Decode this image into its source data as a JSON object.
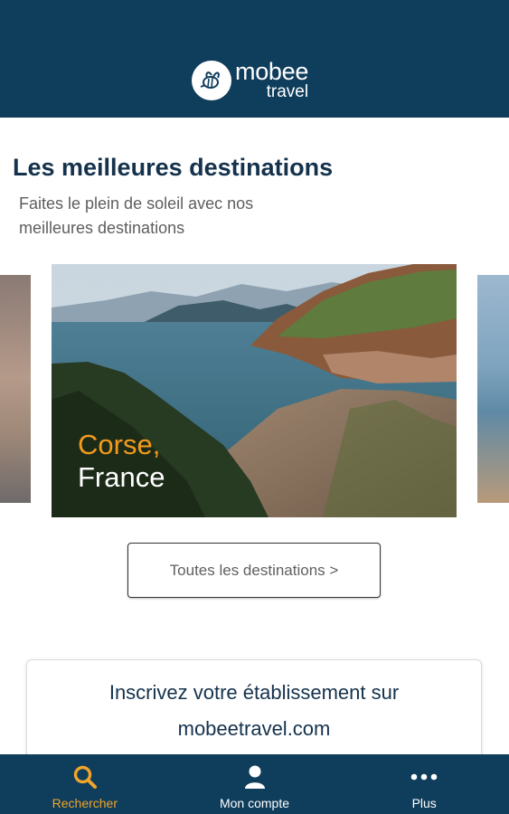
{
  "header": {
    "brand_main": "mobee",
    "brand_sub": "travel",
    "logo_icon": "bee-logo-icon",
    "background": "#0f3d5c"
  },
  "section": {
    "title": "Les meilleures destinations",
    "subtitle": "Faites le plein de soleil avec nos meilleures destinations"
  },
  "carousel": {
    "current": {
      "city": "Corse,",
      "country": "France"
    }
  },
  "all_destinations_button": "Toutes les destinations >",
  "signup": {
    "line1": "Inscrivez votre établissement sur",
    "line2": "mobeetravel.com"
  },
  "bottom_nav": {
    "items": [
      {
        "label": "Rechercher",
        "icon": "search-icon",
        "active": true
      },
      {
        "label": "Mon compte",
        "icon": "user-icon",
        "active": false
      },
      {
        "label": "Plus",
        "icon": "more-dots-icon",
        "active": false
      }
    ]
  },
  "colors": {
    "primary": "#0f3d5c",
    "accent": "#f39a1c",
    "nav_active": "#f0a52a"
  }
}
